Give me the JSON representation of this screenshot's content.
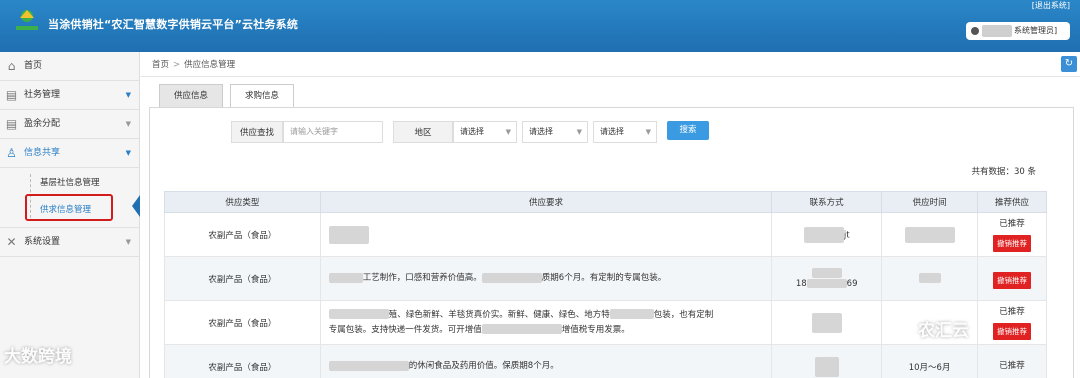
{
  "header": {
    "title": "当涂供销社“农汇智慧数字供销云平台”云社务系统",
    "logout": "[退出系统]",
    "user_role": "系统管理员]"
  },
  "sidebar": {
    "items": [
      {
        "label": "首页",
        "icon": "home-icon"
      },
      {
        "label": "社务管理",
        "icon": "table-icon"
      },
      {
        "label": "盈余分配",
        "icon": "table-icon"
      },
      {
        "label": "信息共享",
        "icon": "people-icon"
      },
      {
        "label": "系统设置",
        "icon": "tools-icon"
      }
    ],
    "sub_items": [
      "基层社信息管理",
      "供求信息管理"
    ]
  },
  "breadcrumb": {
    "home": "首页",
    "sep": ">",
    "current": "供应信息管理"
  },
  "tabs": [
    "供应信息",
    "求购信息"
  ],
  "search": {
    "supply_label": "供应查找",
    "placeholder": "请输入关键字",
    "region_label": "地区",
    "selects": [
      "请选择",
      "请选择",
      "请选择"
    ],
    "button": "搜索"
  },
  "total_text": "共有数据：30 条",
  "table": {
    "headers": [
      "供应类型",
      "供应要求",
      "联系方式",
      "供应时间",
      "推荐供应"
    ],
    "rows": [
      {
        "type": "农副产品（食品）",
        "req1": "",
        "req2": "",
        "contact": "jt",
        "time": "",
        "status": "已推荐",
        "action": "撤销推荐"
      },
      {
        "type": "农副产品（食品）",
        "req1": "工艺制作，口感和营养价值高。",
        "req1b": "质期6个月。有定制的专属包装。",
        "req2": "",
        "contact": "18",
        "contact2": "69",
        "time": "",
        "status": "",
        "action": "撤销推荐"
      },
      {
        "type": "农副产品（食品）",
        "req1": "殖、绿色新鲜、羊毯货真价实。新鲜、健康、绿色、地方特",
        "req1b": "包装，也有定制",
        "req2": "专属包装。支持快递一件发货。可开增值",
        "req2b": "增值税专用发票。",
        "contact": "",
        "time": "",
        "status": "已推荐",
        "action": "撤销推荐"
      },
      {
        "type": "农副产品（食品）",
        "req1": "的休闲食品及药用价值。保质期8个月。",
        "req2": "",
        "contact": "",
        "time": "10月～6月",
        "status": "已推荐",
        "action": ""
      }
    ]
  },
  "watermarks": {
    "left": "大数跨境",
    "right": "农汇云"
  }
}
